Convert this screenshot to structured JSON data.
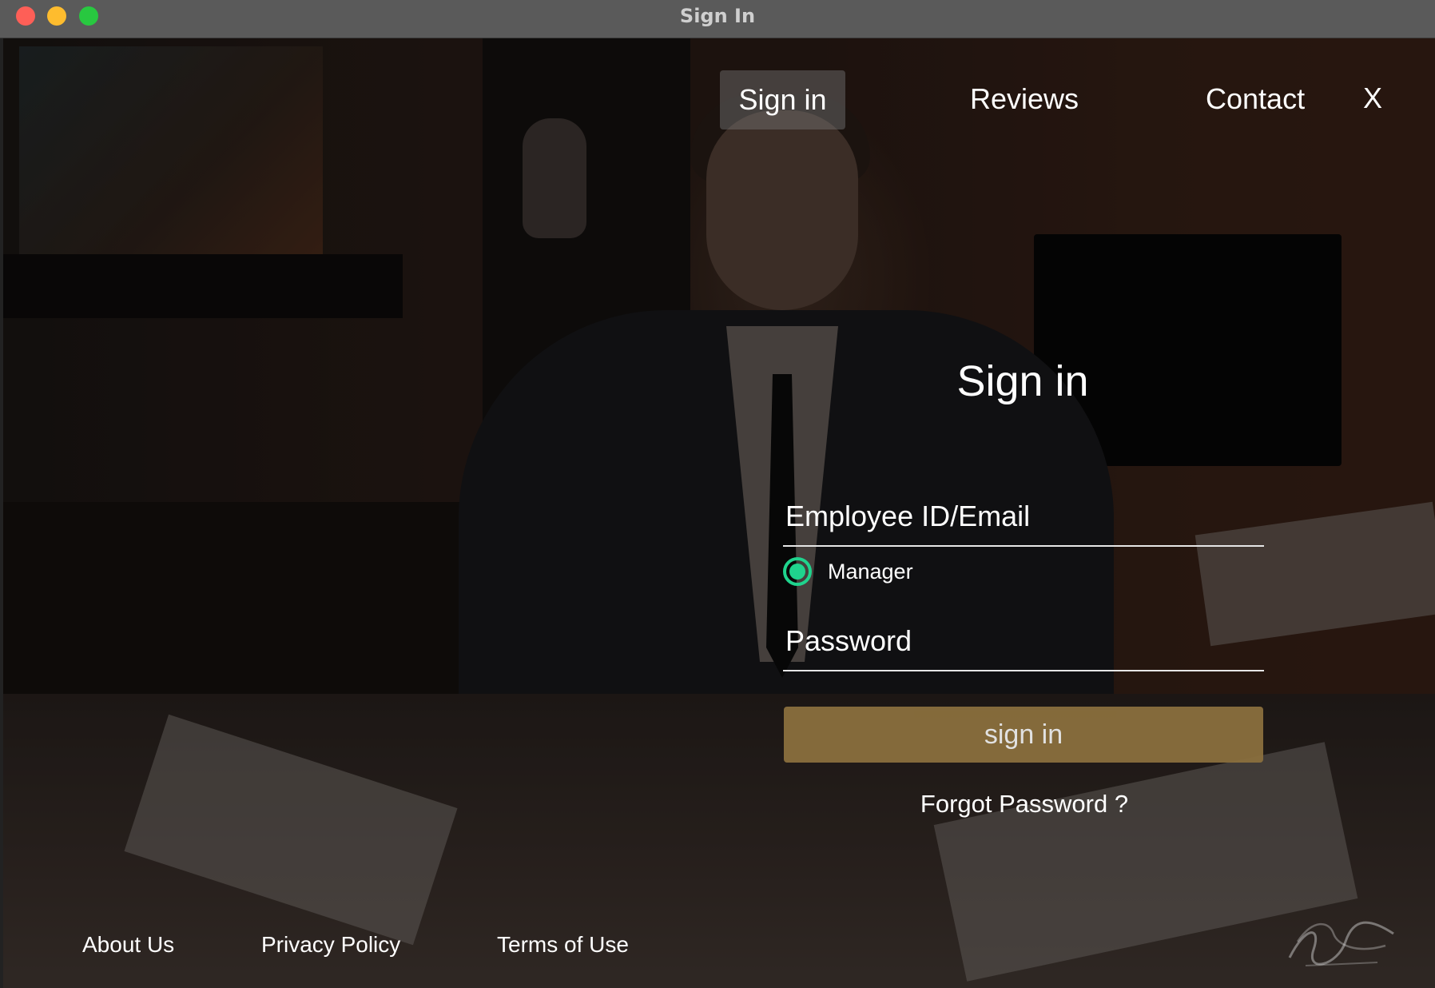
{
  "window": {
    "title": "Sign In"
  },
  "nav": {
    "items": [
      {
        "label": "Sign in",
        "active": true
      },
      {
        "label": "Reviews",
        "active": false
      },
      {
        "label": "Contact",
        "active": false
      }
    ],
    "close_label": "X"
  },
  "form": {
    "title": "Sign in",
    "email_placeholder": "Employee ID/Email",
    "email_value": "",
    "role_label": "Manager",
    "role_selected": true,
    "password_placeholder": "Password",
    "password_value": "",
    "submit_label": "sign in",
    "forgot_label": "Forgot Password ?"
  },
  "footer": {
    "links": [
      "About Us",
      "Privacy Policy",
      "Terms of Use"
    ]
  },
  "colors": {
    "accent_radio": "#1fd38d",
    "button_bg": "#8a6f3d",
    "titlebar": "#5a5a5a"
  },
  "icons": {
    "close": "close-x-icon",
    "radio": "radio-selected-icon"
  },
  "branding": {
    "logo_text": "Estetan Bombonato"
  }
}
